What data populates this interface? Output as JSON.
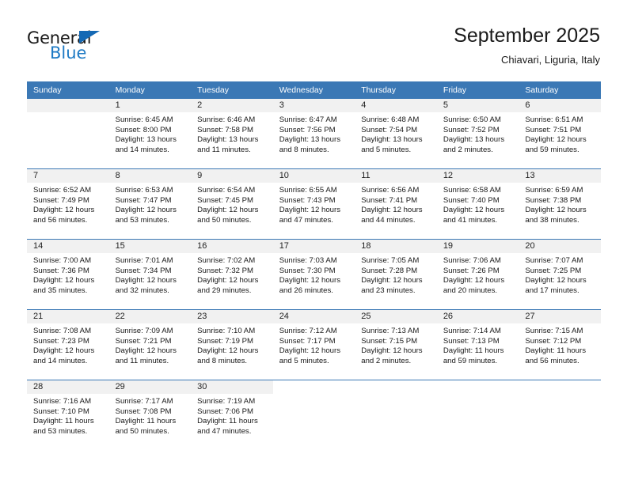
{
  "logo": {
    "word_dark": "General",
    "word_blue": "Blue",
    "triangle_color": "#1569b4",
    "blue_color": "#1e7ac4"
  },
  "header": {
    "month_title": "September 2025",
    "location": "Chiavari, Liguria, Italy"
  },
  "calendar": {
    "header_bg": "#3b78b5",
    "header_text_color": "#ffffff",
    "daynum_band_bg": "#f1f1f1",
    "weekday_headers": [
      "Sunday",
      "Monday",
      "Tuesday",
      "Wednesday",
      "Thursday",
      "Friday",
      "Saturday"
    ],
    "weeks": [
      [
        {
          "day": "",
          "sunrise": "",
          "sunset": "",
          "daylight": "",
          "empty": true
        },
        {
          "day": "1",
          "sunrise": "Sunrise: 6:45 AM",
          "sunset": "Sunset: 8:00 PM",
          "daylight": "Daylight: 13 hours and 14 minutes."
        },
        {
          "day": "2",
          "sunrise": "Sunrise: 6:46 AM",
          "sunset": "Sunset: 7:58 PM",
          "daylight": "Daylight: 13 hours and 11 minutes."
        },
        {
          "day": "3",
          "sunrise": "Sunrise: 6:47 AM",
          "sunset": "Sunset: 7:56 PM",
          "daylight": "Daylight: 13 hours and 8 minutes."
        },
        {
          "day": "4",
          "sunrise": "Sunrise: 6:48 AM",
          "sunset": "Sunset: 7:54 PM",
          "daylight": "Daylight: 13 hours and 5 minutes."
        },
        {
          "day": "5",
          "sunrise": "Sunrise: 6:50 AM",
          "sunset": "Sunset: 7:52 PM",
          "daylight": "Daylight: 13 hours and 2 minutes."
        },
        {
          "day": "6",
          "sunrise": "Sunrise: 6:51 AM",
          "sunset": "Sunset: 7:51 PM",
          "daylight": "Daylight: 12 hours and 59 minutes."
        }
      ],
      [
        {
          "day": "7",
          "sunrise": "Sunrise: 6:52 AM",
          "sunset": "Sunset: 7:49 PM",
          "daylight": "Daylight: 12 hours and 56 minutes."
        },
        {
          "day": "8",
          "sunrise": "Sunrise: 6:53 AM",
          "sunset": "Sunset: 7:47 PM",
          "daylight": "Daylight: 12 hours and 53 minutes."
        },
        {
          "day": "9",
          "sunrise": "Sunrise: 6:54 AM",
          "sunset": "Sunset: 7:45 PM",
          "daylight": "Daylight: 12 hours and 50 minutes."
        },
        {
          "day": "10",
          "sunrise": "Sunrise: 6:55 AM",
          "sunset": "Sunset: 7:43 PM",
          "daylight": "Daylight: 12 hours and 47 minutes."
        },
        {
          "day": "11",
          "sunrise": "Sunrise: 6:56 AM",
          "sunset": "Sunset: 7:41 PM",
          "daylight": "Daylight: 12 hours and 44 minutes."
        },
        {
          "day": "12",
          "sunrise": "Sunrise: 6:58 AM",
          "sunset": "Sunset: 7:40 PM",
          "daylight": "Daylight: 12 hours and 41 minutes."
        },
        {
          "day": "13",
          "sunrise": "Sunrise: 6:59 AM",
          "sunset": "Sunset: 7:38 PM",
          "daylight": "Daylight: 12 hours and 38 minutes."
        }
      ],
      [
        {
          "day": "14",
          "sunrise": "Sunrise: 7:00 AM",
          "sunset": "Sunset: 7:36 PM",
          "daylight": "Daylight: 12 hours and 35 minutes."
        },
        {
          "day": "15",
          "sunrise": "Sunrise: 7:01 AM",
          "sunset": "Sunset: 7:34 PM",
          "daylight": "Daylight: 12 hours and 32 minutes."
        },
        {
          "day": "16",
          "sunrise": "Sunrise: 7:02 AM",
          "sunset": "Sunset: 7:32 PM",
          "daylight": "Daylight: 12 hours and 29 minutes."
        },
        {
          "day": "17",
          "sunrise": "Sunrise: 7:03 AM",
          "sunset": "Sunset: 7:30 PM",
          "daylight": "Daylight: 12 hours and 26 minutes."
        },
        {
          "day": "18",
          "sunrise": "Sunrise: 7:05 AM",
          "sunset": "Sunset: 7:28 PM",
          "daylight": "Daylight: 12 hours and 23 minutes."
        },
        {
          "day": "19",
          "sunrise": "Sunrise: 7:06 AM",
          "sunset": "Sunset: 7:26 PM",
          "daylight": "Daylight: 12 hours and 20 minutes."
        },
        {
          "day": "20",
          "sunrise": "Sunrise: 7:07 AM",
          "sunset": "Sunset: 7:25 PM",
          "daylight": "Daylight: 12 hours and 17 minutes."
        }
      ],
      [
        {
          "day": "21",
          "sunrise": "Sunrise: 7:08 AM",
          "sunset": "Sunset: 7:23 PM",
          "daylight": "Daylight: 12 hours and 14 minutes."
        },
        {
          "day": "22",
          "sunrise": "Sunrise: 7:09 AM",
          "sunset": "Sunset: 7:21 PM",
          "daylight": "Daylight: 12 hours and 11 minutes."
        },
        {
          "day": "23",
          "sunrise": "Sunrise: 7:10 AM",
          "sunset": "Sunset: 7:19 PM",
          "daylight": "Daylight: 12 hours and 8 minutes."
        },
        {
          "day": "24",
          "sunrise": "Sunrise: 7:12 AM",
          "sunset": "Sunset: 7:17 PM",
          "daylight": "Daylight: 12 hours and 5 minutes."
        },
        {
          "day": "25",
          "sunrise": "Sunrise: 7:13 AM",
          "sunset": "Sunset: 7:15 PM",
          "daylight": "Daylight: 12 hours and 2 minutes."
        },
        {
          "day": "26",
          "sunrise": "Sunrise: 7:14 AM",
          "sunset": "Sunset: 7:13 PM",
          "daylight": "Daylight: 11 hours and 59 minutes."
        },
        {
          "day": "27",
          "sunrise": "Sunrise: 7:15 AM",
          "sunset": "Sunset: 7:12 PM",
          "daylight": "Daylight: 11 hours and 56 minutes."
        }
      ],
      [
        {
          "day": "28",
          "sunrise": "Sunrise: 7:16 AM",
          "sunset": "Sunset: 7:10 PM",
          "daylight": "Daylight: 11 hours and 53 minutes."
        },
        {
          "day": "29",
          "sunrise": "Sunrise: 7:17 AM",
          "sunset": "Sunset: 7:08 PM",
          "daylight": "Daylight: 11 hours and 50 minutes."
        },
        {
          "day": "30",
          "sunrise": "Sunrise: 7:19 AM",
          "sunset": "Sunset: 7:06 PM",
          "daylight": "Daylight: 11 hours and 47 minutes."
        },
        {
          "day": "",
          "sunrise": "",
          "sunset": "",
          "daylight": "",
          "empty": true,
          "blank": true
        },
        {
          "day": "",
          "sunrise": "",
          "sunset": "",
          "daylight": "",
          "empty": true,
          "blank": true
        },
        {
          "day": "",
          "sunrise": "",
          "sunset": "",
          "daylight": "",
          "empty": true,
          "blank": true
        },
        {
          "day": "",
          "sunrise": "",
          "sunset": "",
          "daylight": "",
          "empty": true,
          "blank": true
        }
      ]
    ]
  }
}
